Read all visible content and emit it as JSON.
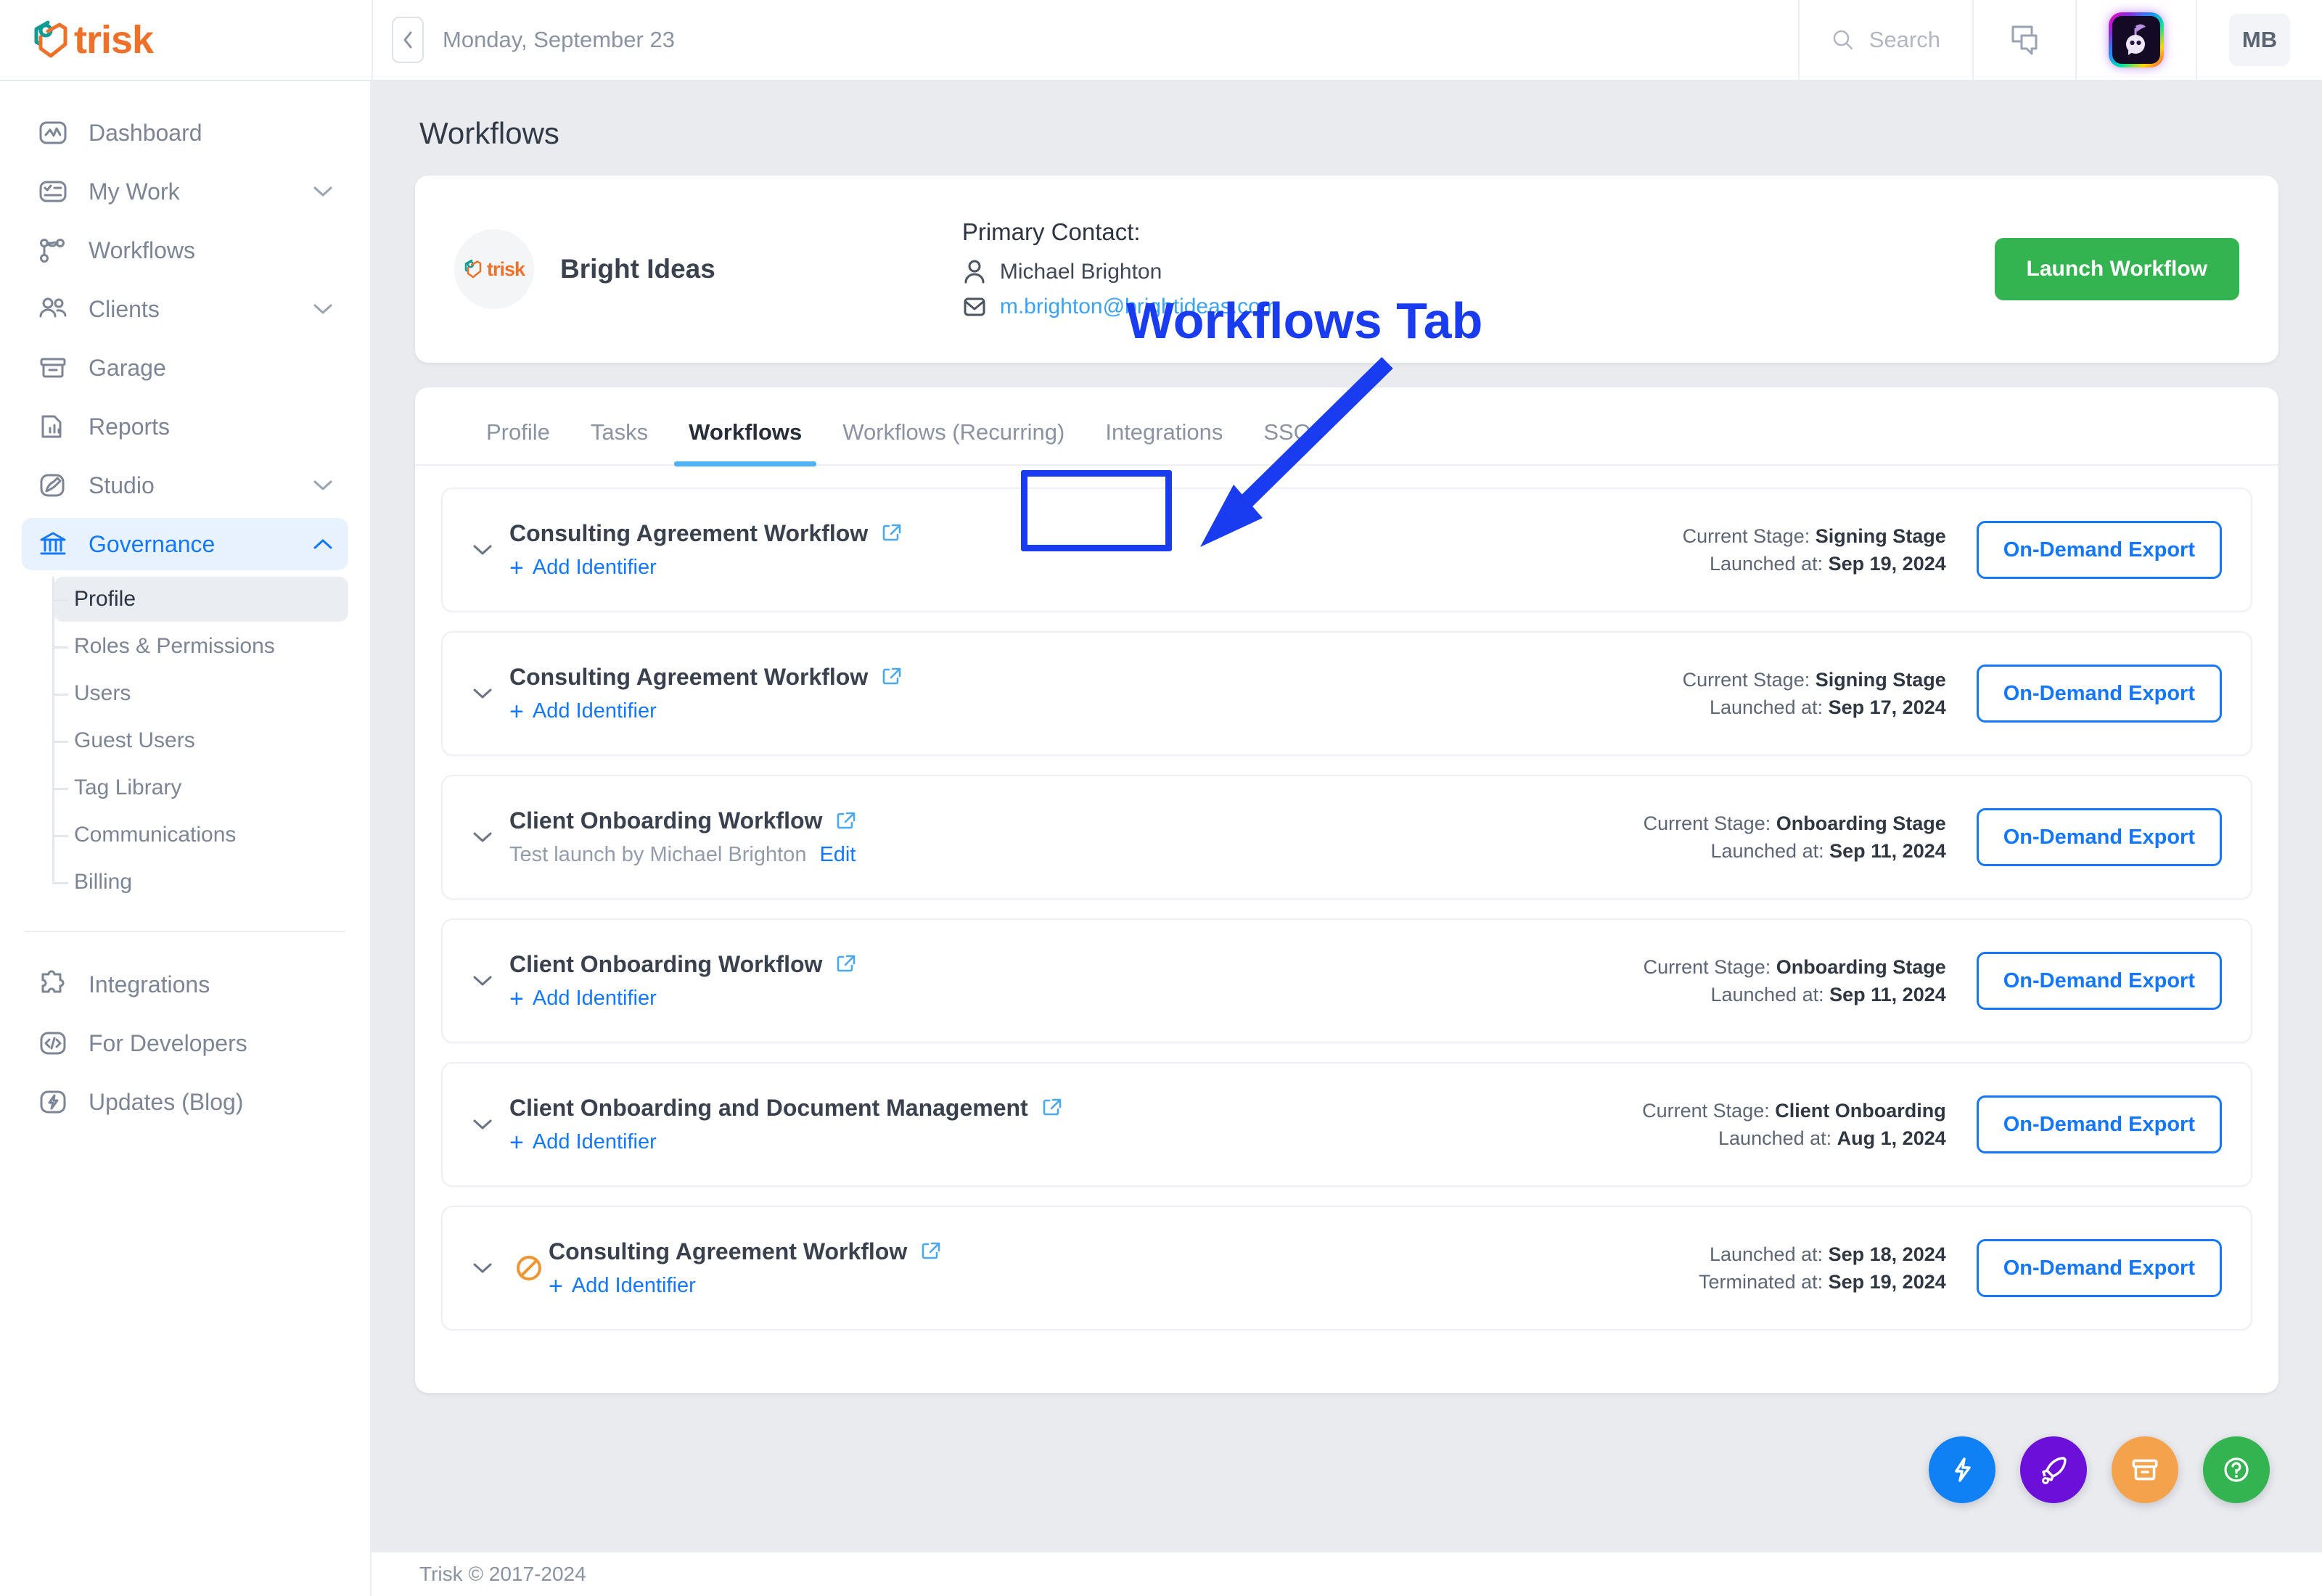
{
  "brand": {
    "name": "trisk"
  },
  "topbar": {
    "collapse_icon": "chevron-left-icon",
    "date": "Monday, September 23",
    "search_placeholder": "Search",
    "search_icon": "search-icon",
    "chat_icon": "chat-bubbles-icon",
    "ai_icon": "ai-assistant-icon",
    "user_initials": "MB"
  },
  "sidebar": {
    "items": [
      {
        "label": "Dashboard",
        "icon": "dashboard-icon",
        "chevron": ""
      },
      {
        "label": "My Work",
        "icon": "checklist-icon",
        "chevron": "⌄"
      },
      {
        "label": "Workflows",
        "icon": "workflow-nodes-icon",
        "chevron": ""
      },
      {
        "label": "Clients",
        "icon": "people-icon",
        "chevron": "⌄"
      },
      {
        "label": "Garage",
        "icon": "archive-box-icon",
        "chevron": ""
      },
      {
        "label": "Reports",
        "icon": "report-chart-icon",
        "chevron": ""
      },
      {
        "label": "Studio",
        "icon": "brush-icon",
        "chevron": "⌄"
      },
      {
        "label": "Governance",
        "icon": "bank-columns-icon",
        "chevron": "⌃"
      }
    ],
    "governance_subitems": [
      {
        "label": "Profile"
      },
      {
        "label": "Roles & Permissions"
      },
      {
        "label": "Users"
      },
      {
        "label": "Guest Users"
      },
      {
        "label": "Tag Library"
      },
      {
        "label": "Communications"
      },
      {
        "label": "Billing"
      }
    ],
    "bottom_items": [
      {
        "label": "Integrations",
        "icon": "puzzle-icon"
      },
      {
        "label": "For Developers",
        "icon": "code-brackets-icon"
      },
      {
        "label": "Updates (Blog)",
        "icon": "lightning-bolt-icon"
      }
    ],
    "active_item": "Governance",
    "current_subitem": "Profile"
  },
  "page": {
    "title": "Workflows"
  },
  "client_header": {
    "client_name": "Bright Ideas",
    "contact_heading": "Primary Contact:",
    "contact_name": "Michael Brighton",
    "contact_email": "m.brighton@brightideas.com",
    "person_icon": "person-icon",
    "mail_icon": "envelope-icon",
    "launch_label": "Launch Workflow"
  },
  "annotation": {
    "label": "Workflows Tab",
    "color": "#1a3cf0"
  },
  "tabs": {
    "items": [
      {
        "label": "Profile"
      },
      {
        "label": "Tasks"
      },
      {
        "label": "Workflows"
      },
      {
        "label": "Workflows (Recurring)"
      },
      {
        "label": "Integrations"
      },
      {
        "label": "SSO"
      }
    ],
    "active_index": 2
  },
  "labels": {
    "add_identifier": "Add Identifier",
    "edit": "Edit",
    "export": "On-Demand Export",
    "current_stage": "Current Stage:",
    "launched_at": "Launched at:",
    "terminated_at": "Terminated at:",
    "external_link_icon": "external-link-icon",
    "expander_icon": "chevron-down-icon",
    "terminated_icon": "prohibition-icon"
  },
  "workflows": [
    {
      "title": "Consulting Agreement Workflow",
      "subtype": "add_identifier",
      "terminated": false,
      "stage": "Signing Stage",
      "launched": "Sep 19, 2024",
      "terminated_at": ""
    },
    {
      "title": "Consulting Agreement Workflow",
      "subtype": "add_identifier",
      "terminated": false,
      "stage": "Signing Stage",
      "launched": "Sep 17, 2024",
      "terminated_at": ""
    },
    {
      "title": "Client Onboarding Workflow",
      "subtype": "note",
      "note": "Test launch by Michael Brighton",
      "terminated": false,
      "stage": "Onboarding Stage",
      "launched": "Sep 11, 2024",
      "terminated_at": ""
    },
    {
      "title": "Client Onboarding Workflow",
      "subtype": "add_identifier",
      "terminated": false,
      "stage": "Onboarding Stage",
      "launched": "Sep 11, 2024",
      "terminated_at": ""
    },
    {
      "title": "Client Onboarding and Document Management",
      "subtype": "add_identifier",
      "terminated": false,
      "stage": "Client Onboarding",
      "launched": "Aug 1, 2024",
      "terminated_at": ""
    },
    {
      "title": "Consulting Agreement Workflow",
      "subtype": "add_identifier",
      "terminated": true,
      "stage": "",
      "launched": "Sep 18, 2024",
      "terminated_at": "Sep 19, 2024"
    }
  ],
  "fabs": [
    {
      "icon": "lightning-bolt-icon",
      "color": "#1080f5"
    },
    {
      "icon": "rocket-icon",
      "color": "#6b0fd9"
    },
    {
      "icon": "archive-box-icon",
      "color": "#f5a council"
    },
    {
      "icon": "question-mark-icon",
      "color": "#34b450"
    }
  ],
  "footer": {
    "text": "Trisk © 2017-2024"
  }
}
